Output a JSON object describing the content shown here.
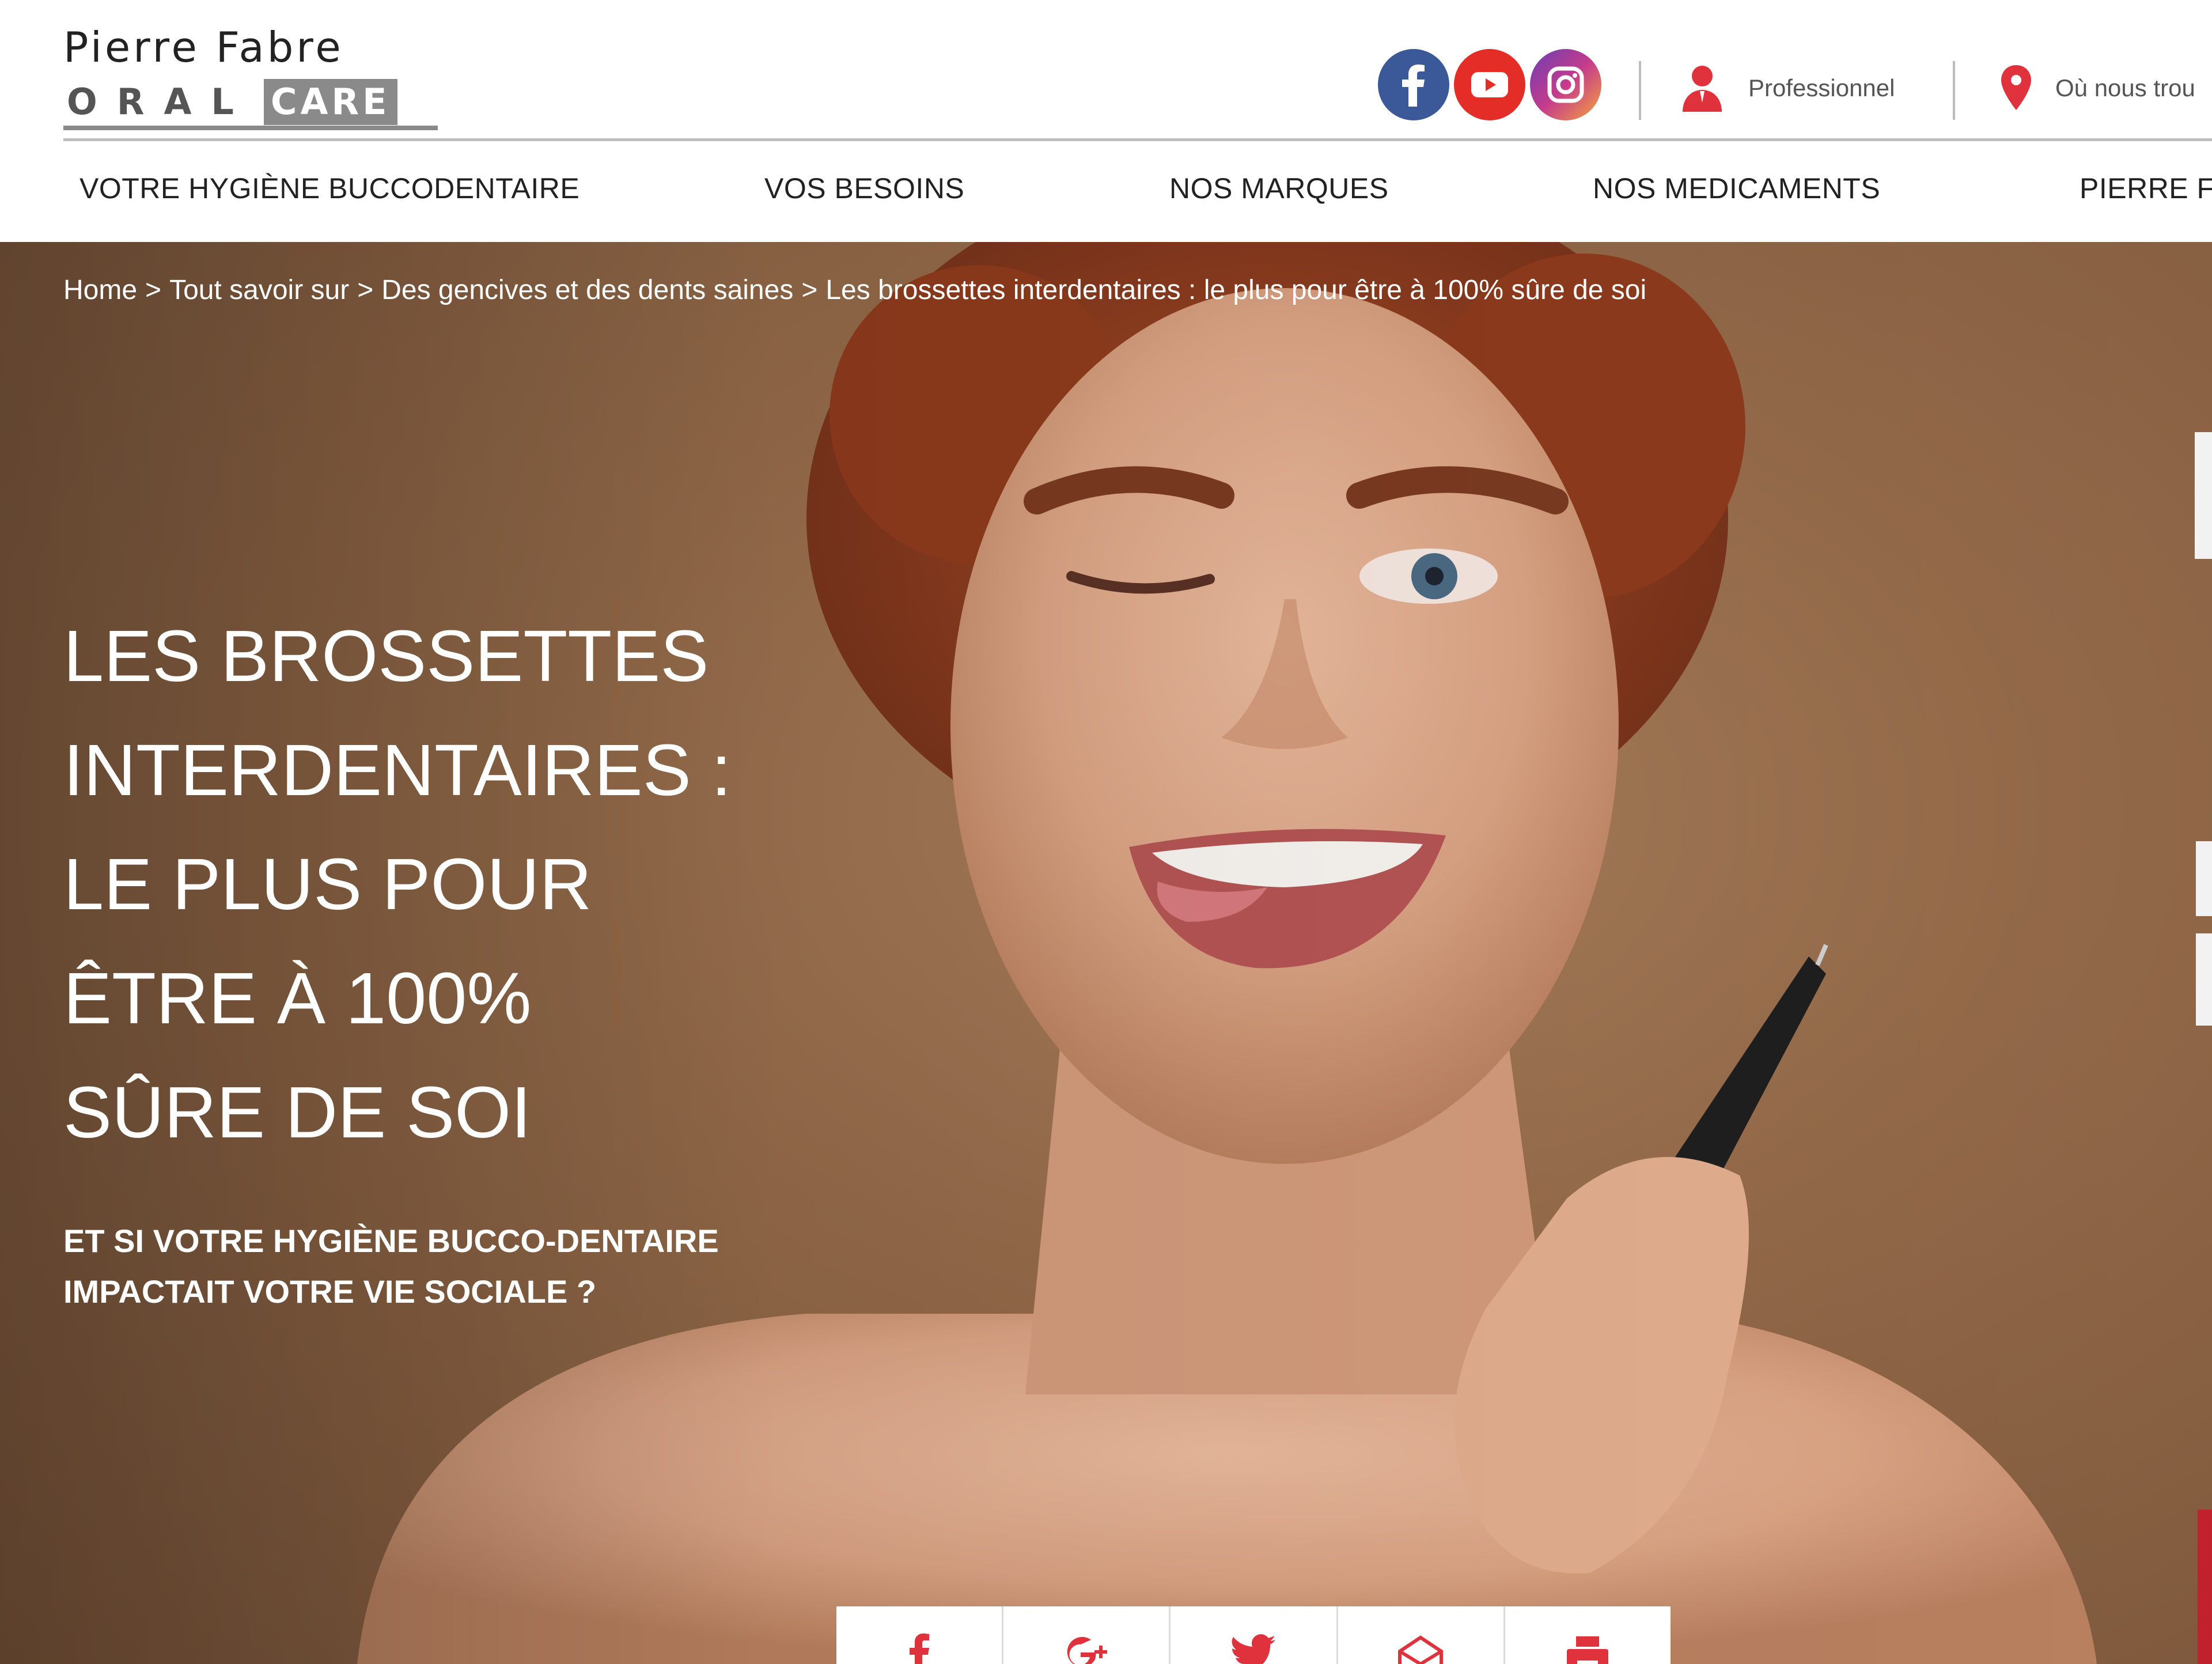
{
  "brand": {
    "line1": "Pierre Fabre",
    "line2_oral": "ORAL",
    "line2_care": "CARE"
  },
  "colors": {
    "accent": "#e0323d",
    "facebook": "#3b5998",
    "youtube": "#e52d27",
    "hero_bg": "#946a49"
  },
  "social": [
    {
      "name": "facebook",
      "icon": "facebook-icon"
    },
    {
      "name": "youtube",
      "icon": "youtube-icon"
    },
    {
      "name": "instagram",
      "icon": "instagram-icon"
    }
  ],
  "utility": {
    "professional_label": "Professionnel",
    "professional_icon": "user-icon",
    "locator_label": "Où nous trou",
    "locator_icon": "map-pin-icon"
  },
  "nav": {
    "items": [
      {
        "label": "VOTRE HYGIÈNE BUCCODENTAIRE"
      },
      {
        "label": "VOS BESOINS"
      },
      {
        "label": "NOS MARQUES"
      },
      {
        "label": "NOS MEDICAMENTS"
      },
      {
        "label": "PIERRE FA"
      }
    ]
  },
  "breadcrumb": {
    "items": [
      {
        "label": "Home"
      },
      {
        "label": "Tout savoir sur"
      },
      {
        "label": "Des gencives et des dents saines"
      },
      {
        "label": "Les brossettes interdentaires : le plus pour être à 100% sûre de soi"
      }
    ],
    "separator": ">"
  },
  "hero": {
    "title_lines": [
      "LES BROSSETTES",
      "INTERDENTAIRES :",
      "LE PLUS POUR",
      "ÊTRE À 100%",
      "SÛRE DE SOI"
    ],
    "subtitle_lines": [
      "ET SI VOTRE HYGIÈNE BUCCO-DENTAIRE",
      "IMPACTAIT VOTRE VIE SOCIALE ?"
    ]
  },
  "share": {
    "buttons": [
      {
        "icon": "facebook-icon"
      },
      {
        "icon": "google-plus-icon"
      },
      {
        "icon": "twitter-icon"
      },
      {
        "icon": "email-icon"
      },
      {
        "icon": "print-icon"
      }
    ]
  }
}
